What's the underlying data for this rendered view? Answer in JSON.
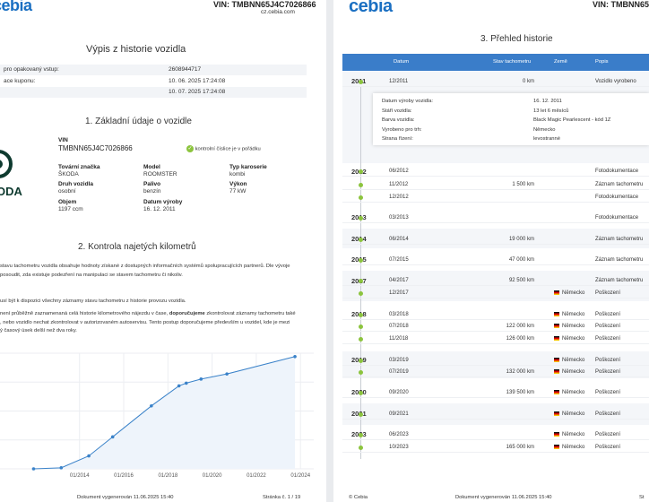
{
  "left": {
    "brand": "cebia",
    "vin_header": "VIN: TMBNN65J4C7026866",
    "site": "cz.cebia.com",
    "title": "Výpis z historie vozidla",
    "info_rows": [
      {
        "label": "pro opakovaný vstup:",
        "value": "2608944717"
      },
      {
        "label": "ace kuponu:",
        "value": "10. 06. 2025 17:24:08"
      },
      {
        "label": "",
        "value": "10. 07. 2025 17:24:08"
      }
    ],
    "section1_title": "1. Základní údaje o vozidle",
    "logo_text": "ODA",
    "vin_label": "VIN",
    "vin_value": "TMBNN65J4C7026866",
    "check_text": "kontrolní číslice je v pořádku",
    "fields": [
      {
        "label": "Tovární značka",
        "value": "ŠKODA"
      },
      {
        "label": "Model",
        "value": "ROOMSTER"
      },
      {
        "label": "Typ karoserie",
        "value": "kombi"
      },
      {
        "label": "Druh vozidla",
        "value": "osobní"
      },
      {
        "label": "Palivo",
        "value": "benzín"
      },
      {
        "label": "Výkon",
        "value": "77 kW"
      },
      {
        "label": "Objem",
        "value": "1197 ccm"
      },
      {
        "label": "Datum výroby",
        "value": "16. 12. 2011"
      }
    ],
    "section2_title": "2. Kontrola najetých kilometrů",
    "para1_line1": "stavu tachometru vozidla obsahuje hodnoty získané z dostupných informačních systémů spolupracujících partnerů. Dle vývoje",
    "para1_line2": "posoudit, zda existuje podezření na manipulaci se stavem tachometru či nikoliv.",
    "para2": "usí být k dispozici všechny záznamy stavu tachometru z historie provozu vozidla.",
    "para3_line1_pre": "není průběžně zaznamenaná celá historie kilometrového nájezdu v čase, ",
    "para3_line1_bold": "doporučujeme",
    "para3_line1_post": " zkontrolovat záznamy tachometru také",
    "para3_line2": ", nebo vozidlo nechat zkontrolovat v autorizovaném autoservisu. Tento postup doporučujeme především u vozidel, kde je mezi",
    "para3_line3": "ý časový úsek delší než dva roky.",
    "footer_center": "Dokument vygenerován 11.06.2025 15:40",
    "footer_right": "Stránka č. 1 / 19"
  },
  "chart_data": {
    "type": "line",
    "title": "",
    "xlabel": "",
    "ylabel": "",
    "x": [
      "12/2011",
      "03/2013",
      "06/2014",
      "07/2015",
      "04/2017",
      "07/2018",
      "11/2018",
      "07/2019",
      "09/2020",
      "10/2023"
    ],
    "x_numeric": [
      2011.92,
      2013.17,
      2014.42,
      2015.5,
      2017.25,
      2018.5,
      2018.83,
      2019.5,
      2020.67,
      2023.75
    ],
    "values": [
      0,
      1500,
      19000,
      47000,
      92500,
      122000,
      126000,
      132000,
      139500,
      165000
    ],
    "tick_labels": [
      "01/2014",
      "01/2016",
      "01/2018",
      "01/2020",
      "01/2022",
      "01/2024"
    ],
    "tick_values": [
      2014,
      2016,
      2018,
      2020,
      2022,
      2024
    ],
    "xlim": [
      2010.4,
      2024.6
    ],
    "ylim": [
      0,
      170000
    ],
    "grid": true,
    "color": "#3a82c9"
  },
  "right": {
    "brand": "cebia",
    "vin_header": "VIN: TMBNN65J4",
    "title": "3. Přehled historie",
    "columns": [
      "Datum",
      "Stav tachometru",
      "Země",
      "Popis"
    ],
    "details": [
      {
        "label": "Datum výroby vozidla:",
        "value": "16. 12. 2011"
      },
      {
        "label": "Stáří vozidla:",
        "value": "13 let 6 měsíců"
      },
      {
        "label": "Barva vozidla:",
        "value": "Black Magic Pearlescent - kód 1Z"
      },
      {
        "label": "Vyrobeno pro trh:",
        "value": "Německo"
      },
      {
        "label": "Strana řízení:",
        "value": "levostranné"
      }
    ],
    "years": [
      "2011",
      "2012",
      "2013",
      "2014",
      "2015",
      "2017",
      "2018",
      "2019",
      "2020",
      "2021",
      "2023"
    ],
    "rows": [
      {
        "date": "12/2011",
        "km": "0 km",
        "country": "",
        "desc": "Vozidlo vyrobeno"
      },
      {
        "date": "06/2012",
        "km": "",
        "country": "",
        "desc": "Fotodokumentace"
      },
      {
        "date": "11/2012",
        "km": "1 500 km",
        "country": "",
        "desc": "Záznam tachometru"
      },
      {
        "date": "12/2012",
        "km": "",
        "country": "",
        "desc": "Fotodokumentace"
      },
      {
        "date": "03/2013",
        "km": "",
        "country": "",
        "desc": "Fotodokumentace"
      },
      {
        "date": "06/2014",
        "km": "19 000 km",
        "country": "",
        "desc": "Záznam tachometru"
      },
      {
        "date": "07/2015",
        "km": "47 000 km",
        "country": "",
        "desc": "Záznam tachometru"
      },
      {
        "date": "04/2017",
        "km": "92 500 km",
        "country": "",
        "desc": "Záznam tachometru"
      },
      {
        "date": "12/2017",
        "km": "",
        "country": "Německo",
        "desc": "Poškození"
      },
      {
        "date": "03/2018",
        "km": "",
        "country": "Německo",
        "desc": "Poškození"
      },
      {
        "date": "07/2018",
        "km": "122 000 km",
        "country": "Německo",
        "desc": "Poškození"
      },
      {
        "date": "11/2018",
        "km": "126 000 km",
        "country": "Německo",
        "desc": "Poškození"
      },
      {
        "date": "03/2019",
        "km": "",
        "country": "Německo",
        "desc": "Poškození"
      },
      {
        "date": "07/2019",
        "km": "132 000 km",
        "country": "Německo",
        "desc": "Poškození"
      },
      {
        "date": "09/2020",
        "km": "139 500 km",
        "country": "Německo",
        "desc": "Poškození"
      },
      {
        "date": "09/2021",
        "km": "",
        "country": "Německo",
        "desc": "Poškození"
      },
      {
        "date": "06/2023",
        "km": "",
        "country": "Německo",
        "desc": "Poškození"
      },
      {
        "date": "10/2023",
        "km": "165 000 km",
        "country": "Německo",
        "desc": "Poškození"
      }
    ],
    "footer_left": "© Cebia",
    "footer_center": "Dokument vygenerován 11.06.2025 15:40",
    "footer_right": "St"
  }
}
